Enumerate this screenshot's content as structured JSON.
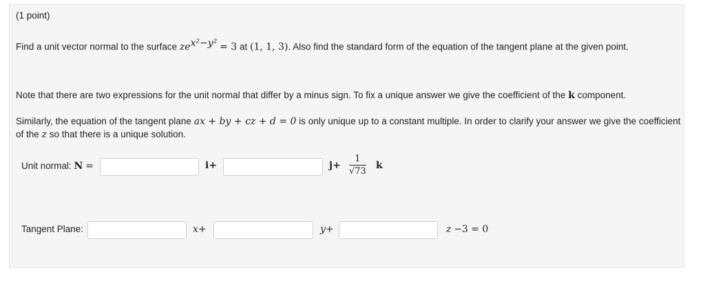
{
  "points": "(1 point)",
  "question": {
    "intro": "Find a unit vector normal to the surface",
    "surface_z": "ze",
    "surface_exp": "x²−y²",
    "surface_rhs": "= 3",
    "at": "at",
    "point": "(1, 1, 3)",
    "rest": ". Also find the standard form of the equation of the tangent plane at the given point."
  },
  "note1": {
    "text": "Note that there are two expressions for the unit normal that differ by a minus sign. To fix a unique answer we give the coefficient of the",
    "k": "k",
    "tail": "component."
  },
  "note2": {
    "pre": "Similarly, the equation of the tangent plane",
    "equation": "ax + by + cz + d = 0",
    "post": "is only unique up to a constant multiple. In order to clarify your answer we give the coefficient",
    "line2_pre": "of the",
    "z": "z",
    "line2_post": "so that there is a unique solution."
  },
  "unit_normal": {
    "label": "Unit normal:",
    "N": "N",
    "eq": "=",
    "i_suffix": "i+",
    "j_suffix": "j+",
    "frac_num": "1",
    "frac_den": "√73",
    "k_suffix": "k",
    "input1_value": "",
    "input2_value": ""
  },
  "tangent_plane": {
    "label": "Tangent Plane:",
    "x_suffix": "x+",
    "y_suffix": "y+",
    "z_term": "z",
    "tail": "−3 = 0",
    "input1_value": "",
    "input2_value": "",
    "input3_value": ""
  }
}
